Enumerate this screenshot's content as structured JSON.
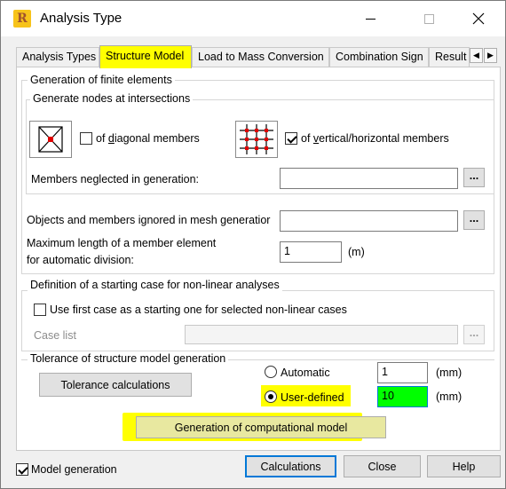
{
  "window": {
    "title": "Analysis Type",
    "logo_letter": "R"
  },
  "tabs": [
    {
      "label": "Analysis Types",
      "active": false
    },
    {
      "label": "Structure Model",
      "active": true
    },
    {
      "label": "Load to Mass Conversion",
      "active": false
    },
    {
      "label": "Combination Sign",
      "active": false
    },
    {
      "label": "Result",
      "active": false
    }
  ],
  "finite_elements": {
    "group_label": "Generation of finite elements",
    "intersections_label": "Generate nodes at intersections",
    "diagonal": {
      "prefix": "of ",
      "accel": "d",
      "rest": "iagonal members",
      "checked": false
    },
    "vertical": {
      "prefix": "of ",
      "accel": "v",
      "rest": "ertical/horizontal members",
      "checked": true
    },
    "neglected_label": "Members neglected in generation:",
    "neglected_value": "",
    "ignored_label": "Objects and members ignored in mesh generatior",
    "ignored_value": "",
    "maxlen_label_1": "Maximum length of a member element",
    "maxlen_label_2": "for automatic division:",
    "maxlen_value": "1",
    "maxlen_unit": "(m)"
  },
  "starting_case": {
    "group_label": "Definition of a starting case for non-linear analyses",
    "checkbox_label": "Use first case as a starting one for selected non-linear cases",
    "checked": false,
    "case_list_label": "Case list",
    "case_list_value": ""
  },
  "tolerance": {
    "group_label": "Tolerance of structure model generation",
    "calc_button": "Tolerance calculations",
    "automatic_label": "Automatic",
    "automatic_value": "1",
    "user_label": "User-defined",
    "user_value": "10",
    "unit": "(mm)",
    "selected": "User-defined"
  },
  "generate_button": "Generation of computational model",
  "footer": {
    "model_generation_label": "Model generation",
    "model_generation_checked": true,
    "calculations": "Calculations",
    "close": "Close",
    "help": "Help"
  },
  "colors": {
    "highlight": "#ffff00",
    "active_input": "#00ff00",
    "focus_border": "#0078d7"
  },
  "icons": [
    "app-logo-icon",
    "minimize-icon",
    "maximize-icon",
    "close-icon",
    "tab-scroll-left-icon",
    "tab-scroll-right-icon",
    "diagonal-mesh-icon",
    "grid-mesh-icon",
    "ellipsis-icon"
  ]
}
